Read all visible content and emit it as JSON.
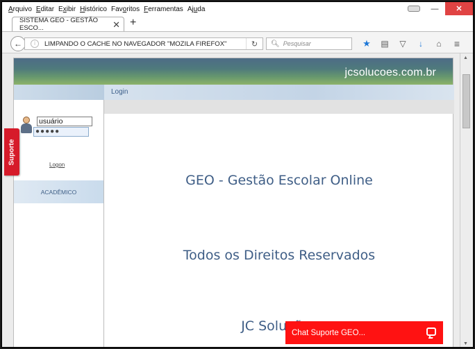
{
  "menu": {
    "items": [
      {
        "accel": "A",
        "rest": "rquivo"
      },
      {
        "accel": "E",
        "rest": "ditar"
      },
      {
        "accel": "x",
        "pre": "E",
        "rest": "ibir"
      },
      {
        "accel": "H",
        "rest": "istórico"
      },
      {
        "accel": "o",
        "pre": "Fav",
        "rest": "ritos"
      },
      {
        "accel": "F",
        "rest": "erramentas"
      },
      {
        "accel": "u",
        "pre": "Aj",
        "rest": "da"
      }
    ]
  },
  "window_controls": {
    "minimize": "—",
    "close": "✕"
  },
  "tab": {
    "title": "SISTEMA GEO - GESTÃO ESCO...",
    "close": "✕",
    "new_tab": "+"
  },
  "navbar": {
    "url": "LIMPANDO O CACHE NO NAVEGADOR \"MOZILA FIREFOX\"",
    "search_placeholder": "Pesquisar"
  },
  "page": {
    "banner": "jcsolucoes.com.br",
    "login_header": "Login",
    "username_value": "usuário",
    "password_value": "●●●●●",
    "logon_link": "Logon",
    "academico": "ACADÊMICO",
    "suporte": "Suporte",
    "line1": "GEO - Gestão Escolar Online",
    "line2": "Todos os Direitos Reservados",
    "line3": "JC Soluções"
  },
  "chat": {
    "label": "Chat Suporte GEO..."
  }
}
